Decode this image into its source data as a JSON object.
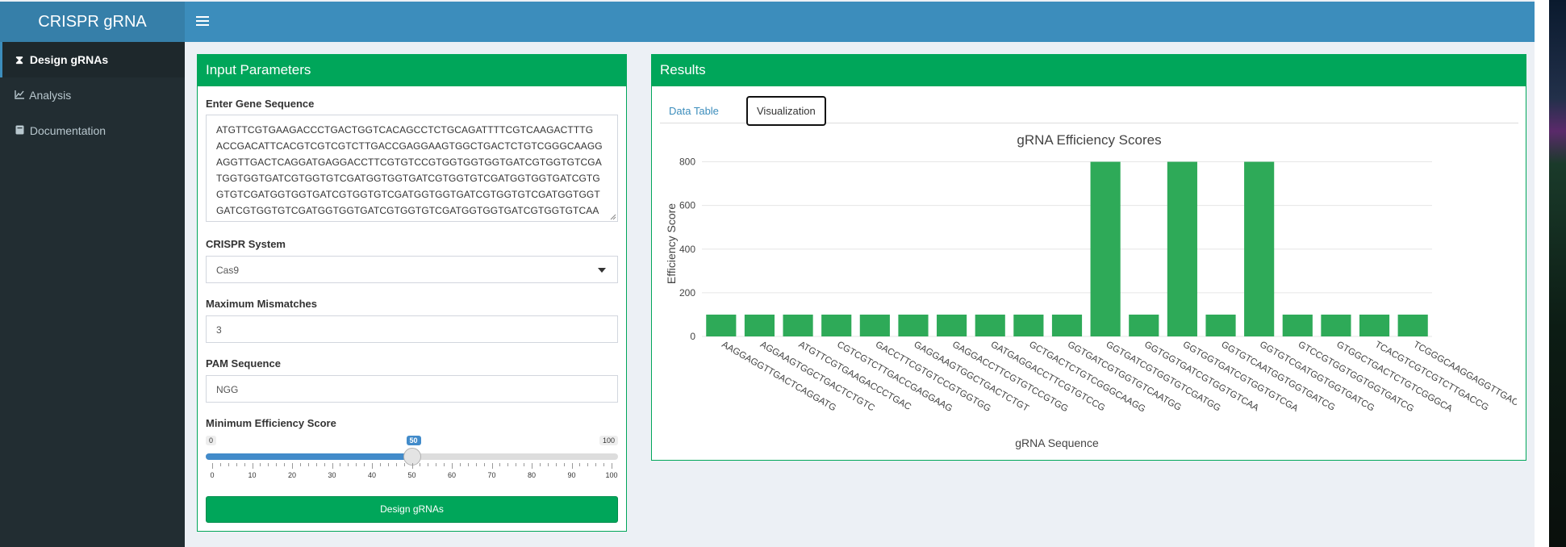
{
  "app": {
    "title": "CRISPR gRNA"
  },
  "sidebar": {
    "items": [
      {
        "label": "Design gRNAs",
        "icon": "hourglass-icon",
        "glyph": "⌛",
        "active": true
      },
      {
        "label": "Analysis",
        "icon": "line-chart-icon",
        "glyph": "📈",
        "active": false
      },
      {
        "label": "Documentation",
        "icon": "book-icon",
        "glyph": "▤",
        "active": false
      }
    ]
  },
  "inputs": {
    "title": "Input Parameters",
    "gene_label": "Enter Gene Sequence",
    "gene_lines": [
      "ATGTTCGTGAAGACCCTGACTGGTCACAGCCTCTGCAGATTTTCGTCAAGACTTTG",
      "ACCGACATTCACGTCGTCGTCTTGACCGAGGAAGTGGCTGACTCTGTCGGGCAAGG",
      "AGGTTGACTCAGGATGAGGACCTTCGTGTCCGTGGTGGTGGTGATCGTGGTGTCGA",
      "TGGTGGTGATCGTGGTGTCGATGGTGGTGATCGTGGTGTCGATGGTGGTGATCGTG",
      "GTGTCGATGGTGGTGATCGTGGTGTCGATGGTGGTGATCGTGGTGTCGATGGTGGT",
      "GATCGTGGTGTCGATGGTGGTGATCGTGGTGTCGATGGTGGTGATCGTGGTGTCAA"
    ],
    "crispr_label": "CRISPR System",
    "crispr_value": "Cas9",
    "mismatch_label": "Maximum Mismatches",
    "mismatch_value": "3",
    "pam_label": "PAM Sequence",
    "pam_value": "NGG",
    "score_label": "Minimum Efficiency Score",
    "slider": {
      "min": "0",
      "max": "100",
      "value": "50",
      "value_num": 50,
      "ticks": [
        "0",
        "10",
        "20",
        "30",
        "40",
        "50",
        "60",
        "70",
        "80",
        "90",
        "100"
      ]
    },
    "button_label": "Design gRNAs"
  },
  "results": {
    "title": "Results",
    "tabs": [
      "Data Table",
      "Visualization"
    ],
    "active_tab": "Visualization"
  },
  "colors": {
    "accent": "#00a65a",
    "header": "#3c8dbc",
    "logo": "#367fa9",
    "sidebar": "#222d32",
    "bar": "#2eaa58",
    "slider": "#428bca"
  },
  "chart_data": {
    "type": "bar",
    "title": "gRNA Efficiency Scores",
    "xlabel": "gRNA Sequence",
    "ylabel": "Efficiency Score",
    "ylim": [
      0,
      850
    ],
    "yticks": [
      0,
      200,
      400,
      600,
      800
    ],
    "grid": true,
    "categories": [
      "AAGGAGGTTGACTCAGGATG",
      "AGGAAGTGGCTGACTCTGTC",
      "ATGTTCGTGAAGACCCTGAC",
      "CGTCGTCTTGACCGAGGAAG",
      "GACCTTCGTGTCCGTGGTGG",
      "GAGGAAGTGGCTGACTCTGT",
      "GAGGACCTTCGTGTCCGTGG",
      "GATGAGGACCTTCGTGTCCG",
      "GCTGACTCTGTCGGGCAAGG",
      "GGTGATCGTGGTGTCAATGG",
      "GGTGATCGTGGTGTCGATGG",
      "GGTGGTGATCGTGGTGTCAA",
      "GGTGGTGATCGTGGTGTCGA",
      "GGTGTCAATGGTGGTGATCG",
      "GGTGTCGATGGTGGTGATCG",
      "GTCCGTGGTGGTGGTGATCG",
      "GTGGCTGACTCTGTCGGGCA",
      "TCACGTCGTCGTCTTGACCG",
      "TCGGGCAAGGAGGTTGACTC"
    ],
    "values": [
      100,
      100,
      100,
      100,
      100,
      100,
      100,
      100,
      100,
      100,
      800,
      100,
      800,
      100,
      800,
      100,
      100,
      100,
      100
    ]
  }
}
